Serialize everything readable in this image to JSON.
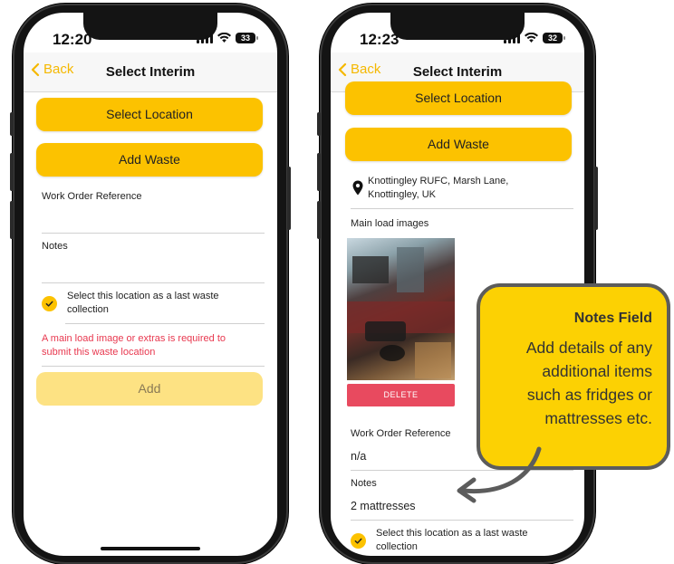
{
  "left_phone": {
    "status": {
      "time": "12:20",
      "battery": "33"
    },
    "nav": {
      "back_label": "Back",
      "title": "Select Interim"
    },
    "buttons": {
      "select_location": "Select Location",
      "add_waste": "Add Waste",
      "add": "Add"
    },
    "fields": {
      "work_order_label": "Work Order Reference",
      "notes_label": "Notes"
    },
    "checkbox": {
      "label_line1": "Select this location as a last waste",
      "label_line2": "collection",
      "checked": true
    },
    "error": {
      "line1": "A main load image or extras is required to",
      "line2": "submit this waste location"
    }
  },
  "right_phone": {
    "status": {
      "time": "12:23",
      "battery": "32"
    },
    "nav": {
      "back_label": "Back",
      "title": "Select Interim"
    },
    "buttons": {
      "select_location": "Select Location",
      "add_waste": "Add Waste",
      "delete": "DELETE"
    },
    "location": {
      "line1": "Knottingley RUFC, Marsh Lane,",
      "line2": "Knottingley, UK"
    },
    "images": {
      "label": "Main load images"
    },
    "fields": {
      "work_order_label": "Work Order Reference",
      "work_order_value": "n/a",
      "notes_label": "Notes",
      "notes_value": "2 mattresses"
    },
    "checkbox": {
      "label_line1": "Select this location as a last waste",
      "label_line2": "collection",
      "checked": true
    }
  },
  "callout": {
    "title": "Notes Field",
    "lines": [
      "Add details of any",
      "additional items",
      "such as fridges or",
      "mattresses etc."
    ]
  },
  "colors": {
    "accent": "#fcc200",
    "accent_disabled": "#fde283",
    "back_link": "#f5b800",
    "error": "#e8384f",
    "delete": "#e84a5f",
    "callout_bg": "#fcd103",
    "callout_border": "#5c5c5c"
  },
  "icons": [
    "chevron-left-icon",
    "signal-icon",
    "wifi-icon",
    "battery-icon",
    "checkmark-icon",
    "location-pin-icon",
    "curved-arrow-icon"
  ]
}
